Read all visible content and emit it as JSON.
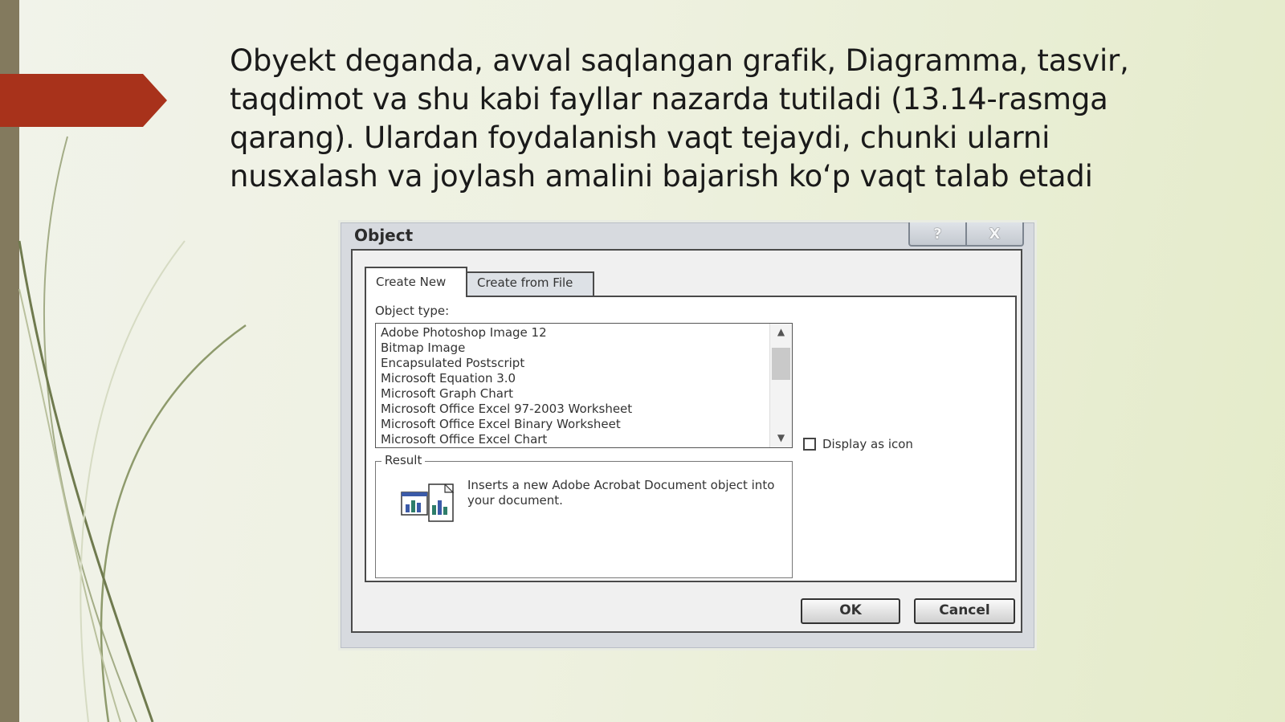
{
  "slide": {
    "text": "Obyekt deganda, avval saqlangan grafik, Diagramma, tasvir, taqdimot va shu kabi fayllar nazarda tutiladi (13.14-rasmga qarang). Ulardan foydalanish vaqt tejaydi, chunki ularni nusxalash va joylash amalini bajarish ko‘p vaqt talab etadi",
    "accent_color": "#a8321b"
  },
  "dialog": {
    "title": "Object",
    "help_button": "?",
    "close_button": "X",
    "tabs": [
      {
        "label": "Create New",
        "active": true
      },
      {
        "label": "Create from File",
        "active": false
      }
    ],
    "object_type_label": "Object type:",
    "object_types": [
      "Adobe Photoshop Image 12",
      "Bitmap Image",
      "Encapsulated Postscript",
      "Microsoft Equation 3.0",
      "Microsoft Graph Chart",
      "Microsoft Office Excel 97-2003 Worksheet",
      "Microsoft Office Excel Binary Worksheet",
      "Microsoft Office Excel Chart"
    ],
    "display_as_icon_label": "Display as icon",
    "display_as_icon_checked": false,
    "result_label": "Result",
    "result_text": "Inserts a new Adobe Acrobat Document object into your document.",
    "ok_label": "OK",
    "cancel_label": "Cancel"
  }
}
